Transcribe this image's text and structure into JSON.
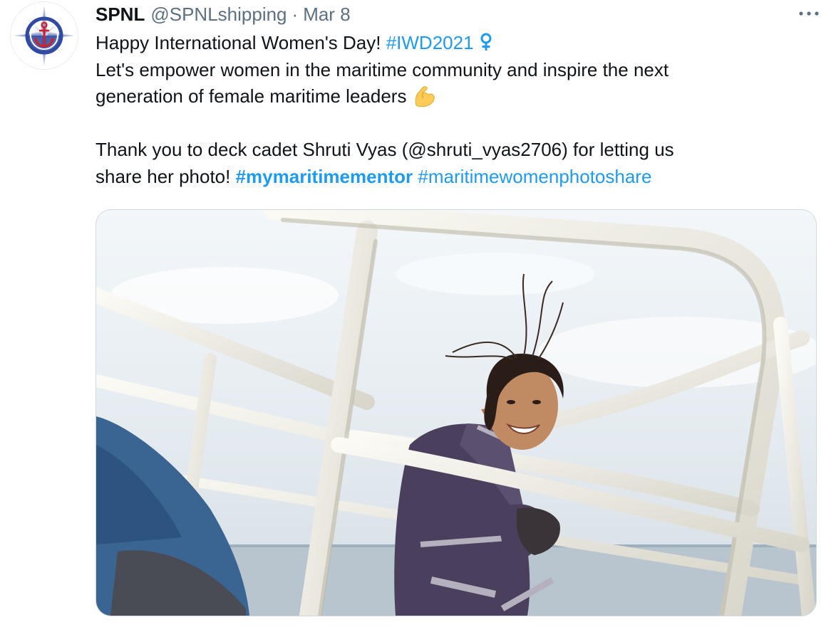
{
  "tweet": {
    "author_name": "SPNL",
    "author_handle": "@SPNLshipping",
    "separator": "·",
    "date": "Mar 8",
    "more_label": "···",
    "text": {
      "line1_prefix": "Happy International Women's Day!",
      "hashtag_iwd": "#IWD2021",
      "female_sign": "♀",
      "line2": "Let's empower women in the maritime community and inspire the next",
      "line3": "generation of female maritime leaders",
      "line4_prefix": "Thank you to deck cadet Shruti Vyas",
      "mention": "(@shruti_vyas2706)",
      "line4_suffix": "for letting us",
      "line5_prefix": "share her photo!",
      "hashtag_mentor": "#mymaritimementor",
      "hashtag_photoshare": "#maritimewomenphotoshare"
    }
  },
  "icons": {
    "avatar": "compass-anchor-logo",
    "flexed_biceps": "flexed-biceps-emoji",
    "more": "more-icon"
  },
  "colors": {
    "link": "#1d9bf0",
    "muted": "#5b7083",
    "text": "#0f1419"
  }
}
